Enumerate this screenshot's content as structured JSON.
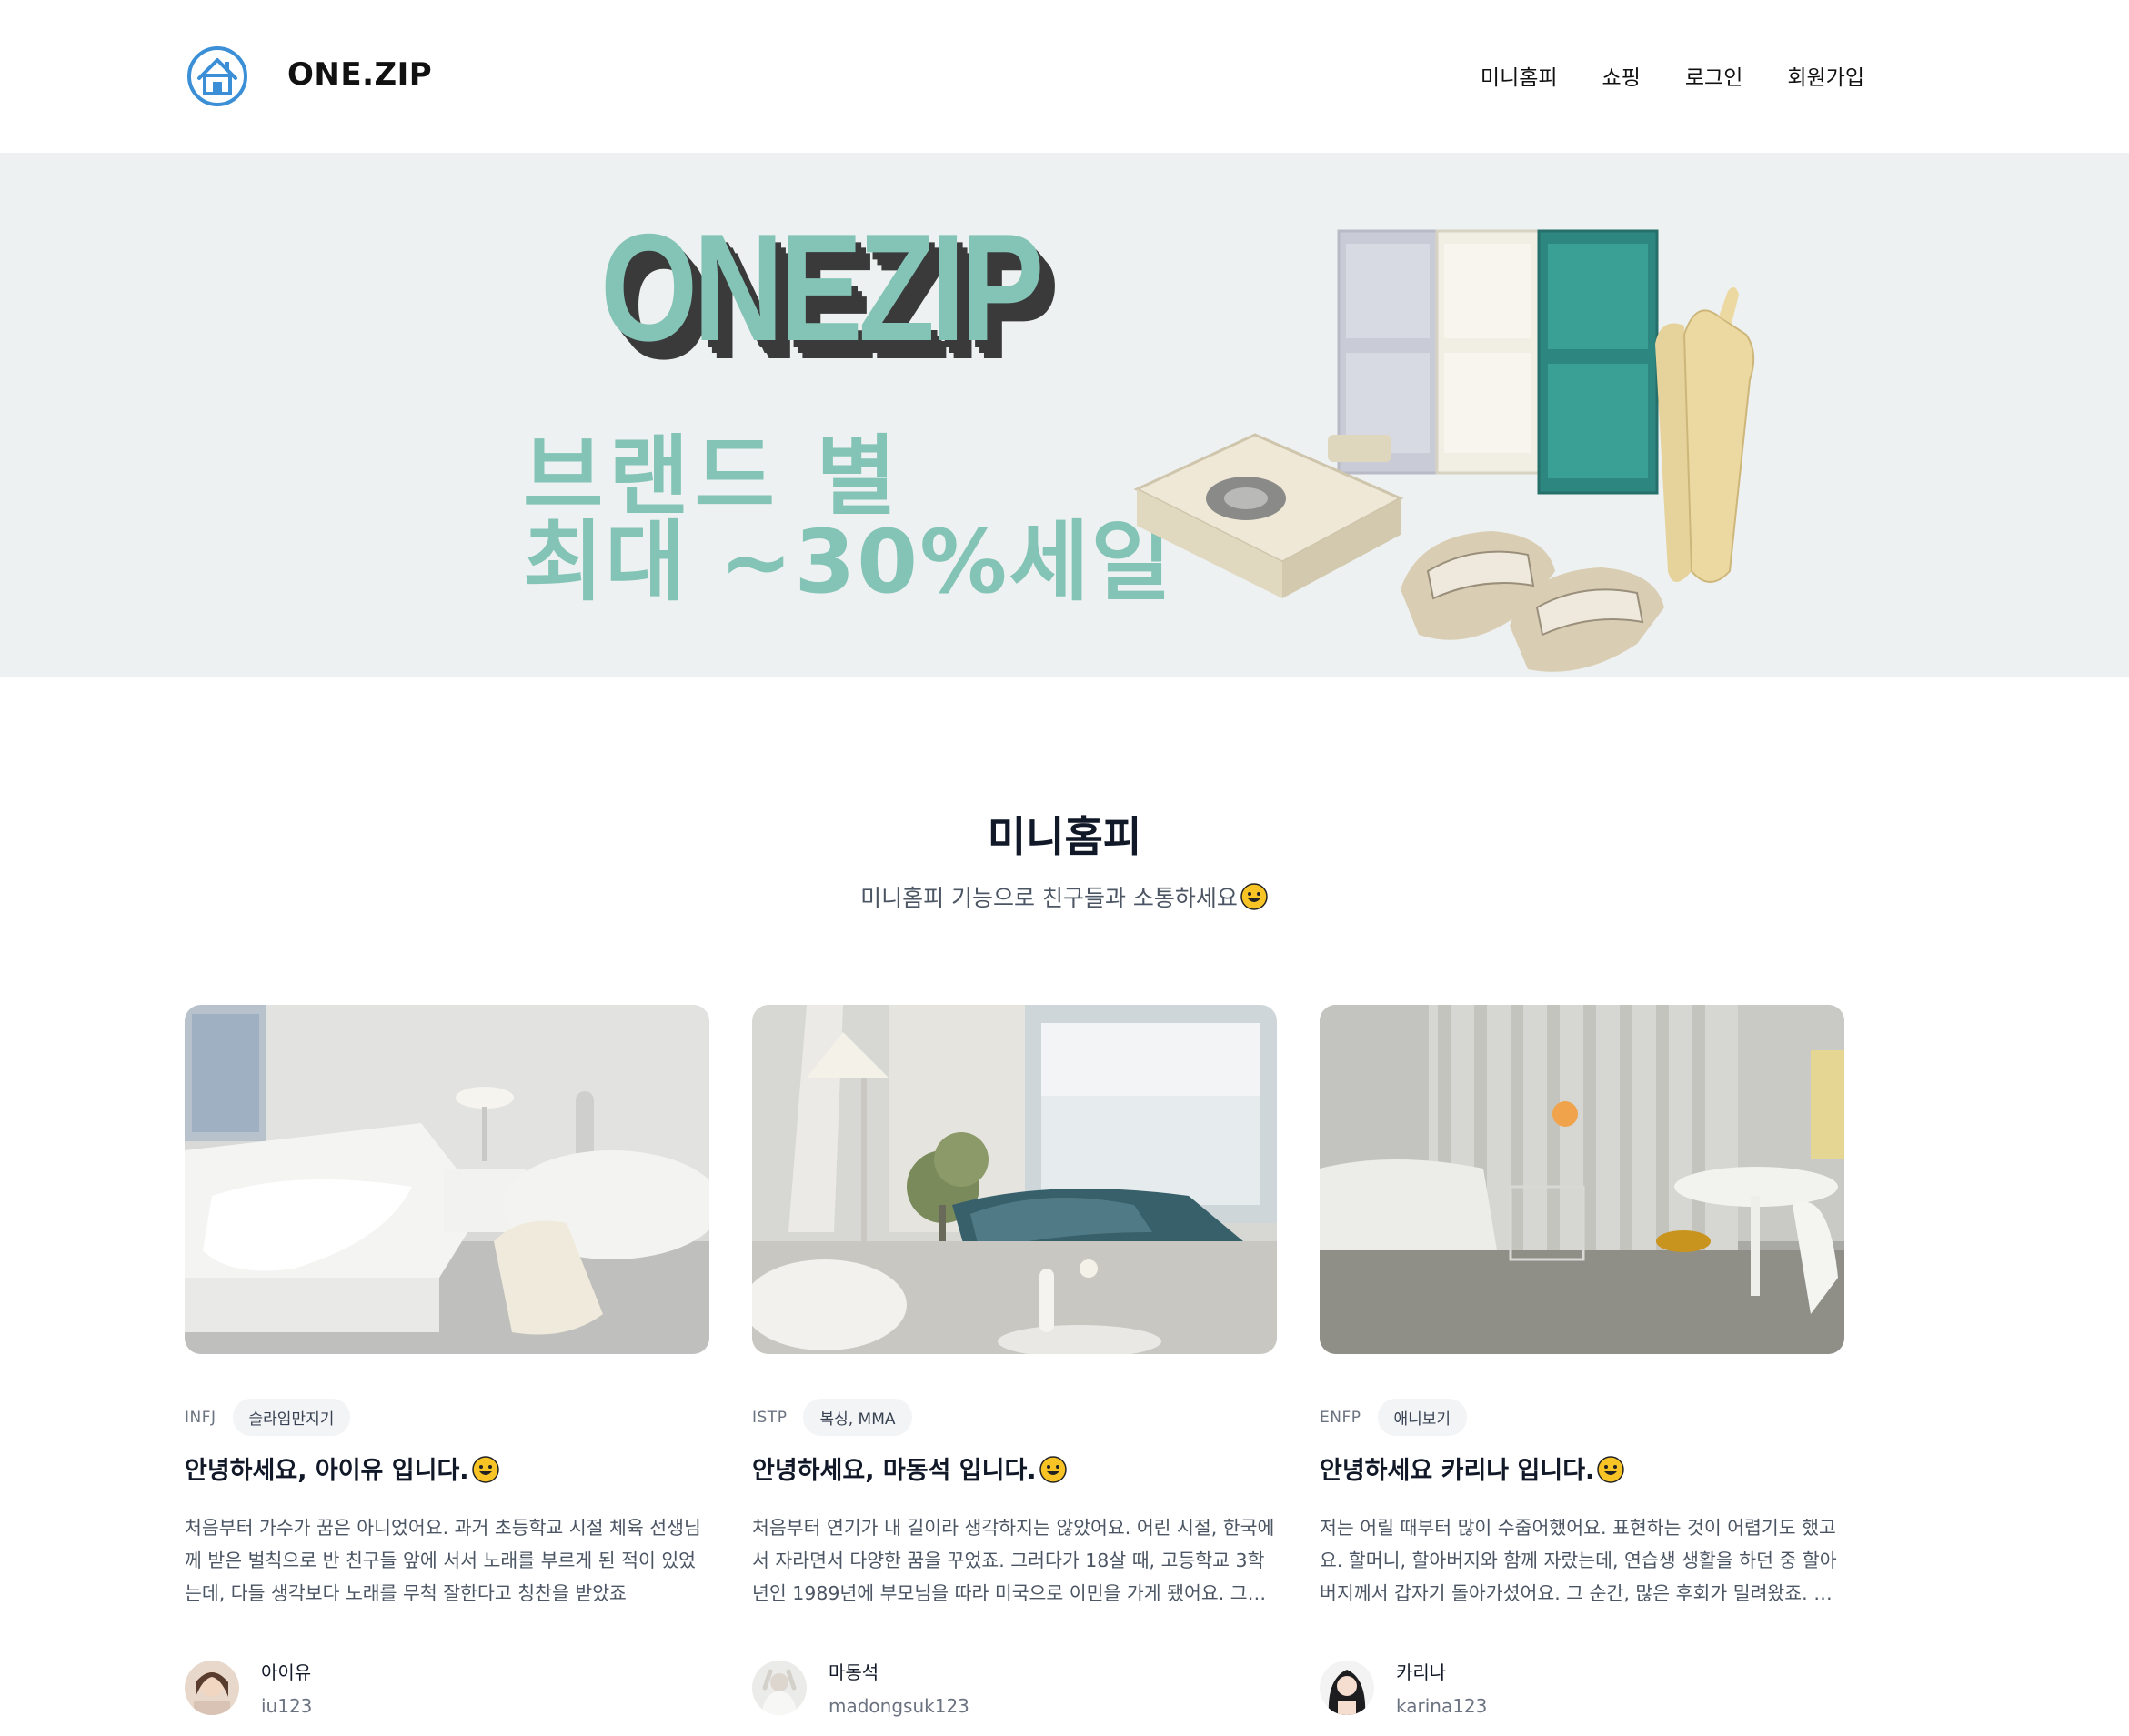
{
  "header": {
    "brand": "ONE.ZIP",
    "nav": [
      "미니홈피",
      "쇼핑",
      "로그인",
      "회원가입"
    ]
  },
  "banner": {
    "logo_text": "ONEZIP",
    "sale_line1": "브랜드 별",
    "sale_line2": "최대 ~30%세일"
  },
  "section": {
    "title": "미니홈피",
    "subtitle": "미니홈피 기능으로 친구들과 소통하세요"
  },
  "cards": [
    {
      "mbti": "INFJ",
      "hobby": "슬라임만지기",
      "title": "안녕하세요, 아이유 입니다.",
      "desc": "처음부터 가수가 꿈은 아니었어요. 과거 초등학교 시절 체육 선생님께 받은 벌칙으로 반 친구들 앞에 서서 노래를 부르게 된 적이 있었는데, 다들 생각보다 노래를 무척 잘한다고 칭찬을 받았죠",
      "author_name": "아이유",
      "author_id": "iu123"
    },
    {
      "mbti": "ISTP",
      "hobby": "복싱, MMA",
      "title": "안녕하세요, 마동석 입니다.",
      "desc": "처음부터 연기가 내 길이라 생각하지는 않았어요. 어린 시절, 한국에서 자라면서 다양한 꿈을 꾸었죠. 그러다가 18살 때, 고등학교 3학년인 1989년에 부모님을 따라 미국으로 이민을 가게 됐어요. 그곳에서 약간의 적응 기간을 거쳤죠.",
      "author_name": "마동석",
      "author_id": "madongsuk123"
    },
    {
      "mbti": "ENFP",
      "hobby": "애니보기",
      "title": "안녕하세요 카리나 입니다.",
      "desc": "저는 어릴 때부터 많이 수줍어했어요. 표현하는 것이 어렵기도 했고요. 할머니, 할아버지와 함께 자랐는데, 연습생 생활을 하던 중 할아버지께서 갑자기 돌아가셨어요. 그 순간, 많은 후회가 밀려왔죠. 제가 더 많은 시간을 함께하지 못했으니까요.",
      "author_name": "카리나",
      "author_id": "karina123"
    }
  ],
  "icons": {
    "logo": "house-icon",
    "emoji": "grinning-face-icon"
  },
  "colors": {
    "accent": "#84c4b6",
    "logo_blue": "#3b8fd6"
  }
}
